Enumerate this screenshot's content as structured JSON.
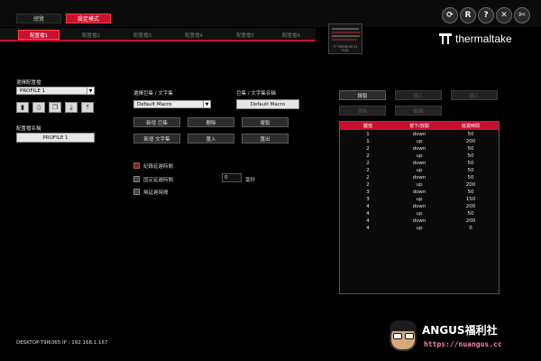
{
  "colors": {
    "accent": "#c8102e",
    "background": "#000000",
    "table_header": "#c8102e"
  },
  "header": {
    "overview_label": "總覽",
    "active_mode_label": "設定模式",
    "tools": [
      {
        "name": "refresh-icon",
        "glyph": "⟳"
      },
      {
        "name": "reset-icon",
        "glyph": "R"
      },
      {
        "name": "help-icon",
        "glyph": "?"
      },
      {
        "name": "close-icon",
        "glyph": "✕"
      },
      {
        "name": "tools-icon",
        "glyph": "✄"
      }
    ],
    "profile_tabs": [
      "配置檔1",
      "配置檔2",
      "配置檔3",
      "配置檔4",
      "配置檔5",
      "配置檔6"
    ],
    "device_caption": "TT PREMIUM X1 RGB",
    "brand": "thermaltake"
  },
  "profile": {
    "select_label": "選擇配置檔",
    "selected": "PROFILE 1",
    "name_label": "配置檔名稱",
    "name_value": "PROFILE 1",
    "icons": [
      "save-icon",
      "delete-icon",
      "copy-icon",
      "import-icon",
      "export-icon"
    ]
  },
  "macro": {
    "select_label": "選擇巨集 / 文字集",
    "selected": "Default Macro",
    "name_label": "巨集 / 文字集名稱",
    "name_value": "Default Macro",
    "buttons": [
      "新增 巨集",
      "刪除",
      "複製",
      "新增 文字集",
      "匯入",
      "匯出"
    ],
    "options": [
      {
        "label": "紀錄延遲時間",
        "checked": true
      },
      {
        "label": "固定延遲時間",
        "checked": false
      },
      {
        "label": "無延遲時間",
        "checked": false
      }
    ],
    "delay_value": "0",
    "delay_unit": "毫秒"
  },
  "editor": {
    "buttons_row1": [
      "錄製",
      "插入",
      "插入"
    ],
    "buttons_row2": [
      "清除",
      "編輯"
    ],
    "table": {
      "headers": [
        "鍵值",
        "按下/放開",
        "延遲時間"
      ],
      "rows": [
        [
          "1",
          "down",
          "50"
        ],
        [
          "1",
          "up",
          "200"
        ],
        [
          "2",
          "down",
          "50"
        ],
        [
          "2",
          "up",
          "50"
        ],
        [
          "2",
          "down",
          "50"
        ],
        [
          "2",
          "up",
          "50"
        ],
        [
          "2",
          "down",
          "50"
        ],
        [
          "2",
          "up",
          "200"
        ],
        [
          "3",
          "down",
          "50"
        ],
        [
          "3",
          "up",
          "150"
        ],
        [
          "4",
          "down",
          "200"
        ],
        [
          "4",
          "up",
          "50"
        ],
        [
          "4",
          "down",
          "200"
        ],
        [
          "4",
          "up",
          "0"
        ]
      ]
    }
  },
  "footer": {
    "status": "DESKTOP-T9I6365 IP : 192.168.1.167"
  },
  "watermark": {
    "title": "ANGUS福利社",
    "url": "https://nuangus.cc"
  }
}
